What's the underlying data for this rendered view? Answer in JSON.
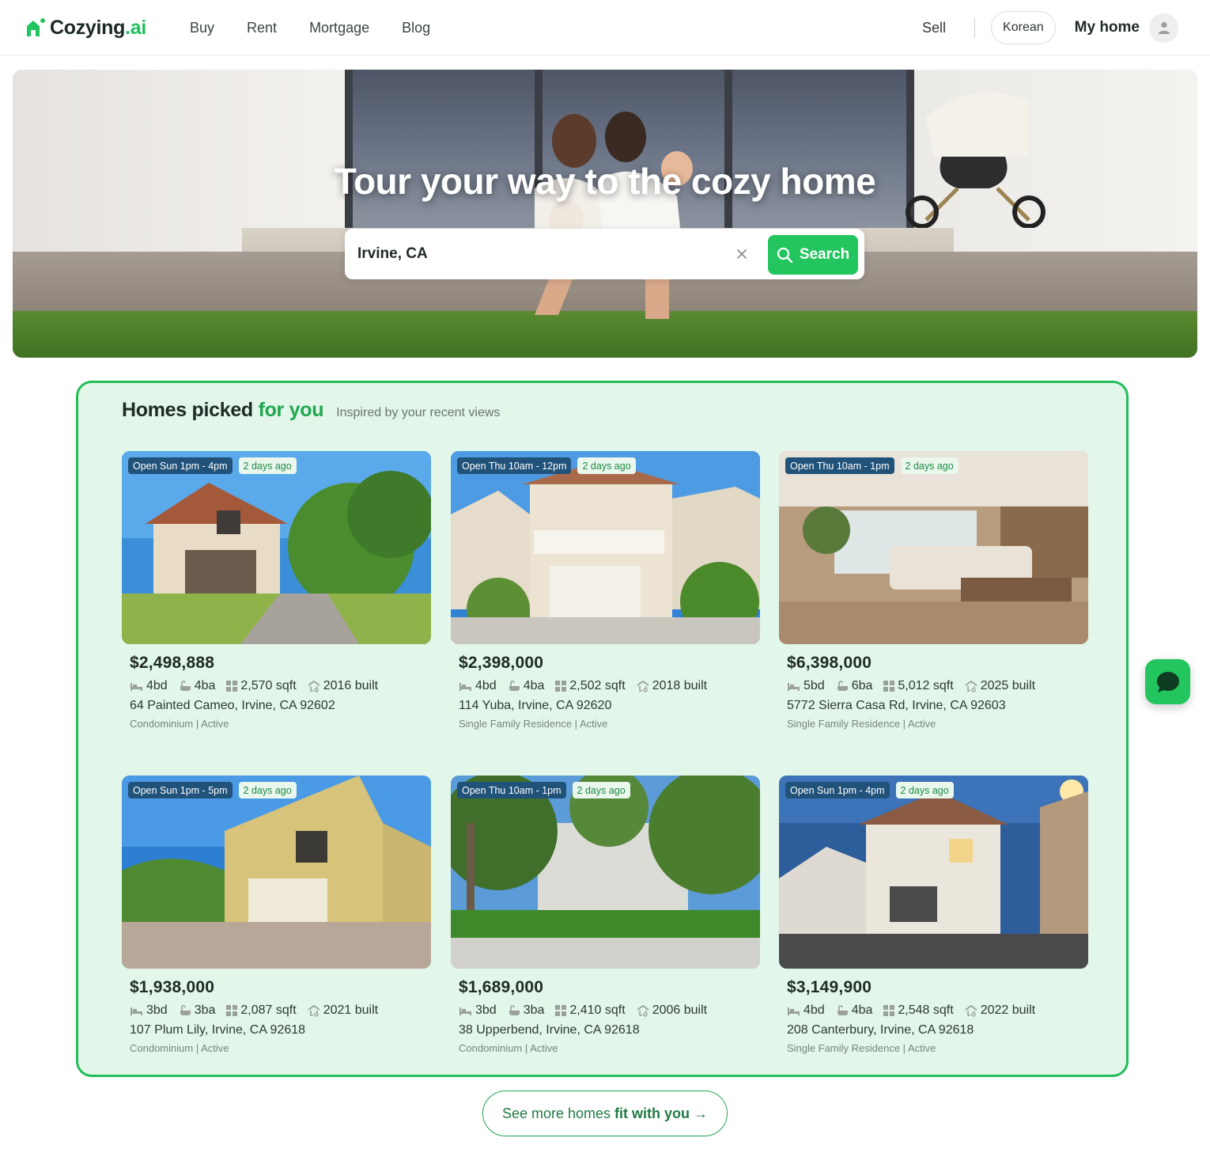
{
  "brand": {
    "name": "Cozying",
    "suffix": ".ai",
    "accent": "#22c55e"
  },
  "nav": {
    "items": [
      "Buy",
      "Rent",
      "Mortgage",
      "Blog"
    ]
  },
  "header": {
    "sell": "Sell",
    "language": "Korean",
    "my_home": "My home"
  },
  "hero": {
    "title": "Tour your way to the cozy home",
    "search_value": "Irvine, CA",
    "search_button": "Search"
  },
  "picks": {
    "title": "Homes picked ",
    "title_highlight": "for you",
    "subtitle": "Inspired by your recent views",
    "listings": [
      {
        "open": "Open Sun 1pm - 4pm",
        "age": "2 days ago",
        "price": "$2,498,888",
        "beds": "4bd",
        "baths": "4ba",
        "sqft": "2,570 sqft",
        "built": "2016 built",
        "address": "64 Painted Cameo, Irvine, CA 92602",
        "meta": "Condominium | Active"
      },
      {
        "open": "Open Thu 10am - 12pm",
        "age": "2 days ago",
        "price": "$2,398,000",
        "beds": "4bd",
        "baths": "4ba",
        "sqft": "2,502 sqft",
        "built": "2018 built",
        "address": "114 Yuba, Irvine, CA 92620",
        "meta": "Single Family Residence | Active"
      },
      {
        "open": "Open Thu 10am - 1pm",
        "age": "2 days ago",
        "price": "$6,398,000",
        "beds": "5bd",
        "baths": "6ba",
        "sqft": "5,012 sqft",
        "built": "2025 built",
        "address": "5772 Sierra Casa Rd, Irvine, CA 92603",
        "meta": "Single Family Residence | Active"
      },
      {
        "open": "Open Sun 1pm - 5pm",
        "age": "2 days ago",
        "price": "$1,938,000",
        "beds": "3bd",
        "baths": "3ba",
        "sqft": "2,087 sqft",
        "built": "2021 built",
        "address": "107 Plum Lily, Irvine, CA 92618",
        "meta": "Condominium | Active"
      },
      {
        "open": "Open Thu 10am - 1pm",
        "age": "2 days ago",
        "price": "$1,689,000",
        "beds": "3bd",
        "baths": "3ba",
        "sqft": "2,410 sqft",
        "built": "2006 built",
        "address": "38 Upperbend, Irvine, CA 92618",
        "meta": "Condominium | Active"
      },
      {
        "open": "Open Sun 1pm - 4pm",
        "age": "2 days ago",
        "price": "$3,149,900",
        "beds": "4bd",
        "baths": "4ba",
        "sqft": "2,548 sqft",
        "built": "2022 built",
        "address": "208 Canterbury, Irvine, CA 92618",
        "meta": "Single Family Residence | Active"
      }
    ]
  },
  "more_button": {
    "label": "See more homes",
    "label_bold": "fit with you →"
  },
  "icons": {
    "bed": "bed-icon",
    "bath": "bath-icon",
    "sqft": "sqft-icon",
    "built": "built-icon",
    "search": "search-icon",
    "clear": "close-icon",
    "user": "user-icon",
    "chat": "chat-icon"
  }
}
